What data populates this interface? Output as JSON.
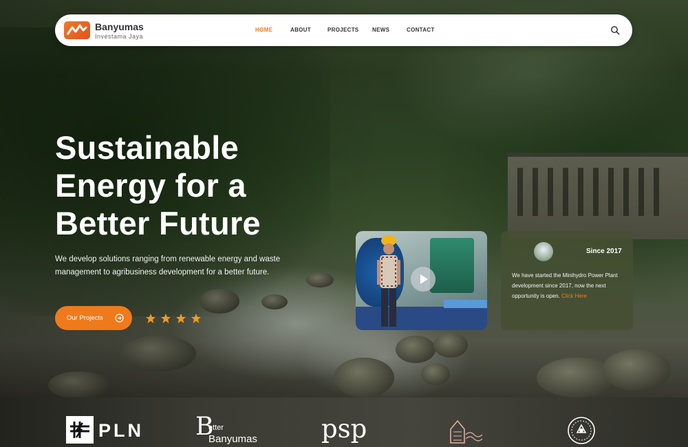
{
  "brand": {
    "name": "Banyumas",
    "subtitle": "Investama Jaya"
  },
  "nav": {
    "items": [
      {
        "label": "HOME",
        "active": true
      },
      {
        "label": "ABOUT",
        "active": false
      },
      {
        "label": "PROJECTS",
        "active": false
      },
      {
        "label": "NEWS",
        "active": false
      },
      {
        "label": "CONTACT",
        "active": false
      }
    ],
    "search_icon": "search-icon"
  },
  "hero": {
    "headline_line1": "Sustainable",
    "headline_line2": "Energy for a",
    "headline_line3": "Better Future",
    "description": "We develop solutions ranging from renewable energy and waste management to agribusiness development for a better future.",
    "cta_label": "Our Projects",
    "cta_icon": "arrow-circle-right-icon",
    "rating_stars": 4
  },
  "video_card": {
    "play_icon": "play-icon"
  },
  "info_card": {
    "since": "Since 2017",
    "text": "We have started the Minihydro Power Plant development since 2017, now the next opportunity is open.",
    "link_text": "Click Here"
  },
  "partners": {
    "pln": "PLN",
    "better_banyumas_line1": "etter",
    "better_banyumas_line2": "Banyumas",
    "psp": "psp"
  },
  "colors": {
    "accent": "#ef7a1c",
    "nav_bg": "#ffffff",
    "info_card_bg": "#464e32"
  }
}
